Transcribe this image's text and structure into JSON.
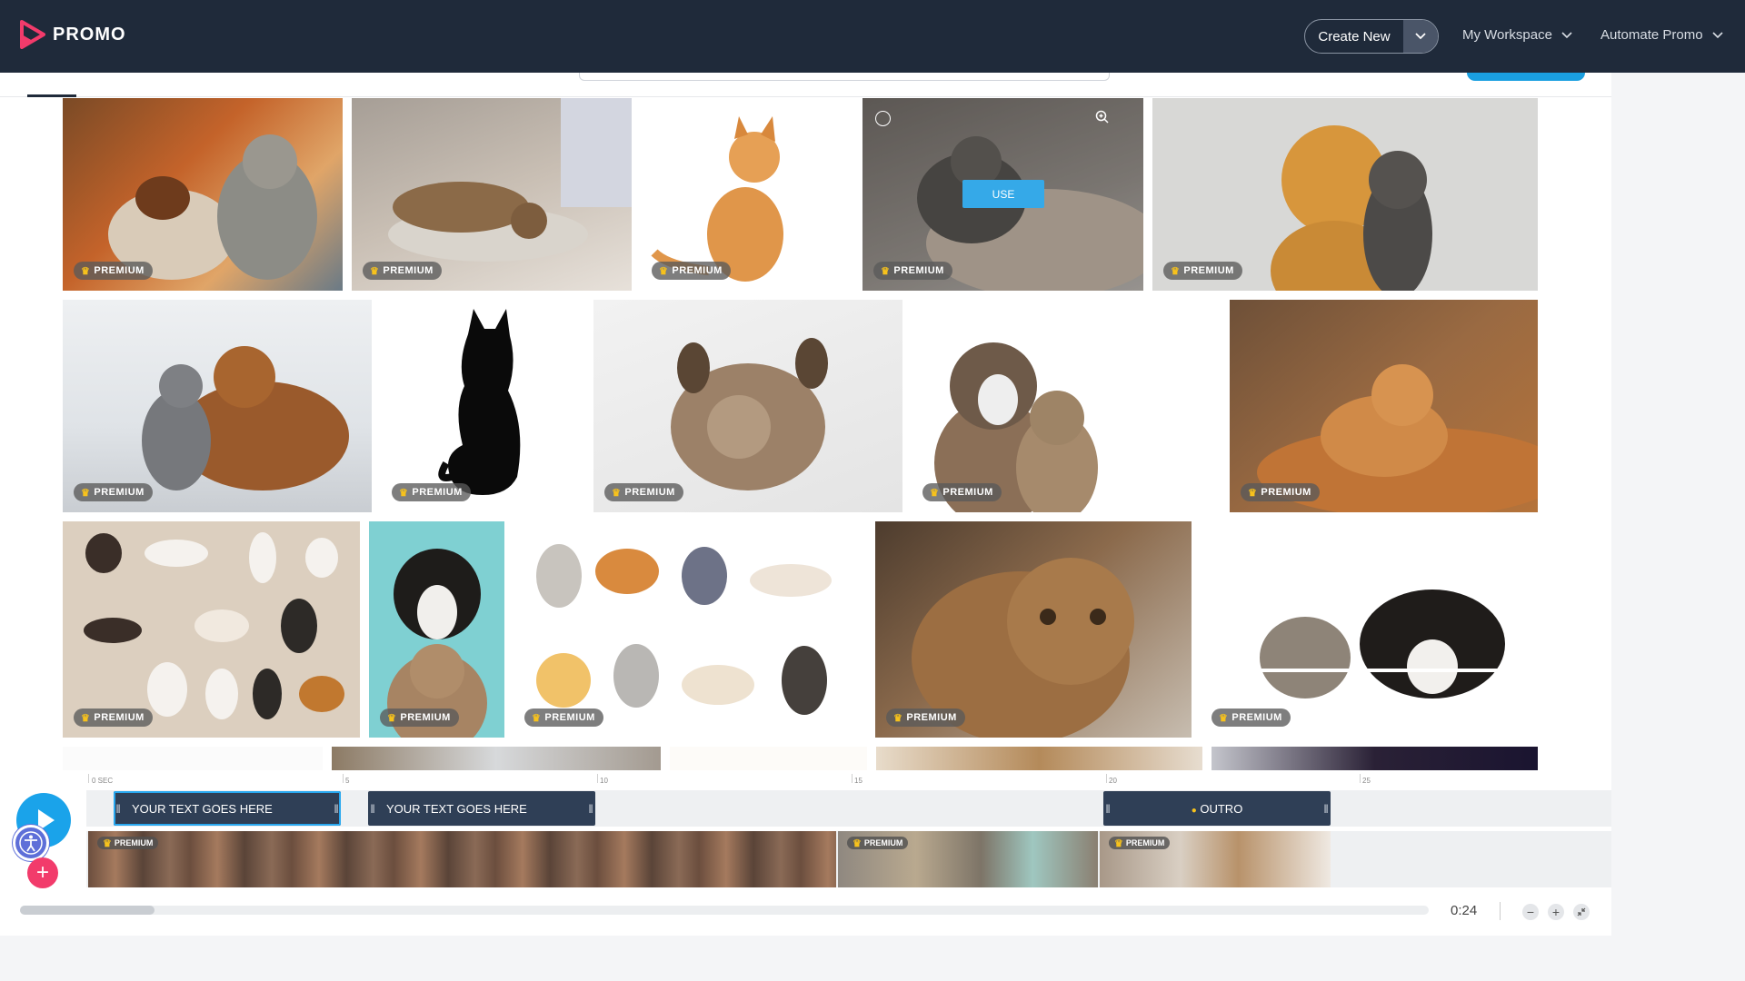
{
  "app": {
    "brand": "PROMO",
    "brand_color": "#f23b6b",
    "accent": "#1aa3ea",
    "topbar_color": "#1f2a3a"
  },
  "header": {
    "create_label": "Create New",
    "menus": [
      {
        "label": "My Workspace"
      },
      {
        "label": "Automate Promo"
      }
    ]
  },
  "gallery": {
    "badge_label": "PREMIUM",
    "hover_action": "USE",
    "tiles": [
      {
        "name": "cat-dog-owner",
        "premium": true
      },
      {
        "name": "tabby-stretch",
        "premium": true
      },
      {
        "name": "orange-kitten-sitting",
        "premium": true
      },
      {
        "name": "cat-dog-sleeping",
        "premium": true,
        "hovered": true
      },
      {
        "name": "golden-retriever-cat",
        "premium": true
      },
      {
        "name": "kitten-puppy-cuddle",
        "premium": true
      },
      {
        "name": "black-cat-silhouette",
        "premium": true
      },
      {
        "name": "kitten-sleeping-paws-up",
        "premium": true
      },
      {
        "name": "aussie-dog-tabby",
        "premium": true
      },
      {
        "name": "orange-cat-on-bed",
        "premium": true
      },
      {
        "name": "cat-illustrations-set",
        "premium": true
      },
      {
        "name": "border-collie-cat-teal",
        "premium": true
      },
      {
        "name": "cartoon-cats-set",
        "premium": true
      },
      {
        "name": "tabby-closeup",
        "premium": true
      },
      {
        "name": "cat-dog-peeking",
        "premium": true
      }
    ]
  },
  "timeline": {
    "ruler": [
      "0 SEC",
      "5",
      "10",
      "15",
      "20",
      "25"
    ],
    "text_clips": [
      {
        "label": "YOUR TEXT GOES HERE"
      },
      {
        "label": "YOUR TEXT GOES HERE"
      },
      {
        "label": "OUTRO"
      }
    ],
    "video_badge": "PREMIUM",
    "duration": "0:24"
  }
}
